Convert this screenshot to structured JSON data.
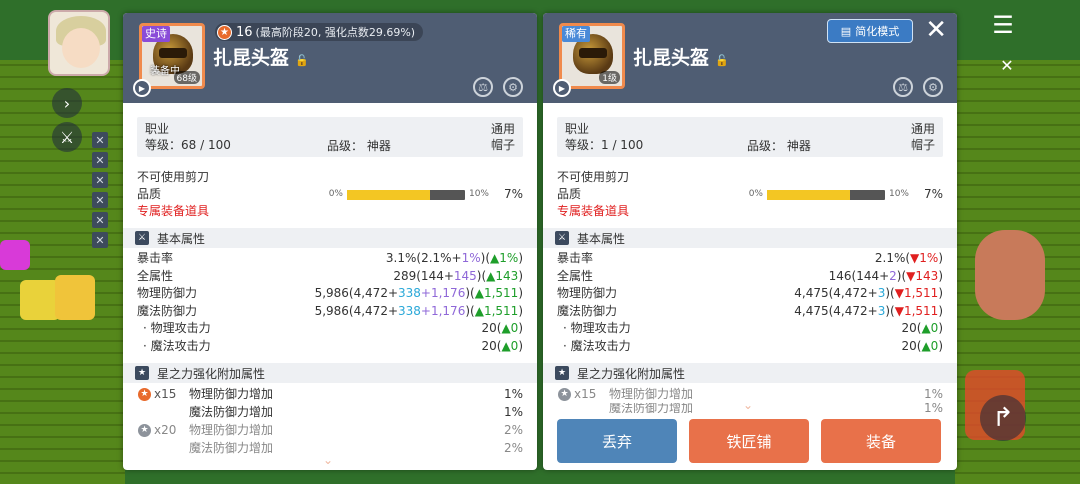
{
  "left": {
    "rarity": "史诗",
    "equipped": "装备中",
    "level_tag": "68级",
    "star_count": "16",
    "star_detail": "(最高阶段20, 强化点数29.69%)",
    "item_name": "扎昆头盔",
    "job_label": "职业",
    "job_value": "通用",
    "level_label": "等级：68 / 100",
    "grade_label": "品级： 神器",
    "slot_value": "帽子",
    "scissors": "不可使用剪刀",
    "quality_label": "品质",
    "quality_min": "0%",
    "quality_max": "10%",
    "quality_value": "7%",
    "quality_fill": 0.7,
    "exclusive": "专属装备道具",
    "basic_header": "基本属性",
    "stats": [
      {
        "label": "暴击率",
        "base": "3.1%(2.1%+",
        "add": "1%",
        "add2": "",
        "close": ")(",
        "delta": "▲1%",
        "end": ")"
      },
      {
        "label": "全属性",
        "base": "289(144+",
        "add": "145",
        "add2": "",
        "close": ")(",
        "delta": "▲143",
        "end": ")"
      },
      {
        "label": "物理防御力",
        "base": "5,986(4,472+",
        "add": "338",
        "add2": "+1,176",
        "close": ")(",
        "delta": "▲1,511",
        "end": ")"
      },
      {
        "label": "魔法防御力",
        "base": "5,986(4,472+",
        "add": "338",
        "add2": "+1,176",
        "close": ")(",
        "delta": "▲1,511",
        "end": ")"
      },
      {
        "label": "· 物理攻击力",
        "base": "20(",
        "add": "",
        "add2": "",
        "close": "",
        "delta": "▲0",
        "end": ")"
      },
      {
        "label": "· 魔法攻击力",
        "base": "20(",
        "add": "",
        "add2": "",
        "close": "",
        "delta": "▲0",
        "end": ")"
      }
    ],
    "star_header": "星之力强化附加属性",
    "star_tiers": [
      {
        "x": "x15",
        "rows": [
          {
            "label": "物理防御力增加",
            "val": "1%"
          },
          {
            "label": "魔法防御力增加",
            "val": "1%"
          }
        ]
      },
      {
        "x": "x20",
        "rows": [
          {
            "label": "物理防御力增加",
            "val": "2%"
          },
          {
            "label": "魔法防御力增加",
            "val": "2%"
          }
        ]
      }
    ]
  },
  "right": {
    "rarity": "稀有",
    "level_tag": "1级",
    "simple_mode": "简化模式",
    "close_label": "✕",
    "item_name": "扎昆头盔",
    "job_label": "职业",
    "job_value": "通用",
    "level_label": "等级：1 / 100",
    "grade_label": "品级： 神器",
    "slot_value": "帽子",
    "scissors": "不可使用剪刀",
    "quality_label": "品质",
    "quality_min": "0%",
    "quality_max": "10%",
    "quality_value": "7%",
    "quality_fill": 0.7,
    "exclusive": "专属装备道具",
    "basic_header": "基本属性",
    "stats": [
      {
        "label": "暴击率",
        "base": "2.1%(",
        "add": "",
        "add2": "",
        "close": "",
        "delta": "▼1%",
        "end": ")"
      },
      {
        "label": "全属性",
        "base": "146(144+",
        "add": "2",
        "add2": "",
        "close": ")(",
        "delta": "▼143",
        "end": ")"
      },
      {
        "label": "物理防御力",
        "base": "4,475(4,472+",
        "add": "3",
        "add2": "",
        "close": ")(",
        "delta": "▼1,511",
        "end": ")"
      },
      {
        "label": "魔法防御力",
        "base": "4,475(4,472+",
        "add": "3",
        "add2": "",
        "close": ")(",
        "delta": "▼1,511",
        "end": ")"
      },
      {
        "label": "· 物理攻击力",
        "base": "20(",
        "add": "",
        "add2": "",
        "close": "",
        "delta": "▲0",
        "end": ")"
      },
      {
        "label": "· 魔法攻击力",
        "base": "20(",
        "add": "",
        "add2": "",
        "close": "",
        "delta": "▲0",
        "end": ")"
      }
    ],
    "star_header": "星之力强化附加属性",
    "star_tier": {
      "x": "x15",
      "label": "物理防御力增加",
      "val": "1%",
      "label2": "魔法防御力增加",
      "val2": "1%"
    },
    "buttons": {
      "discard": "丢弃",
      "blacksmith": "铁匠铺",
      "equip": "装备"
    }
  },
  "colors": {
    "header": "#4f5d73",
    "accent_orange": "#e8714a",
    "accent_blue": "#4f85b8",
    "up": "#1e9e2a",
    "down": "#e01f1f"
  }
}
